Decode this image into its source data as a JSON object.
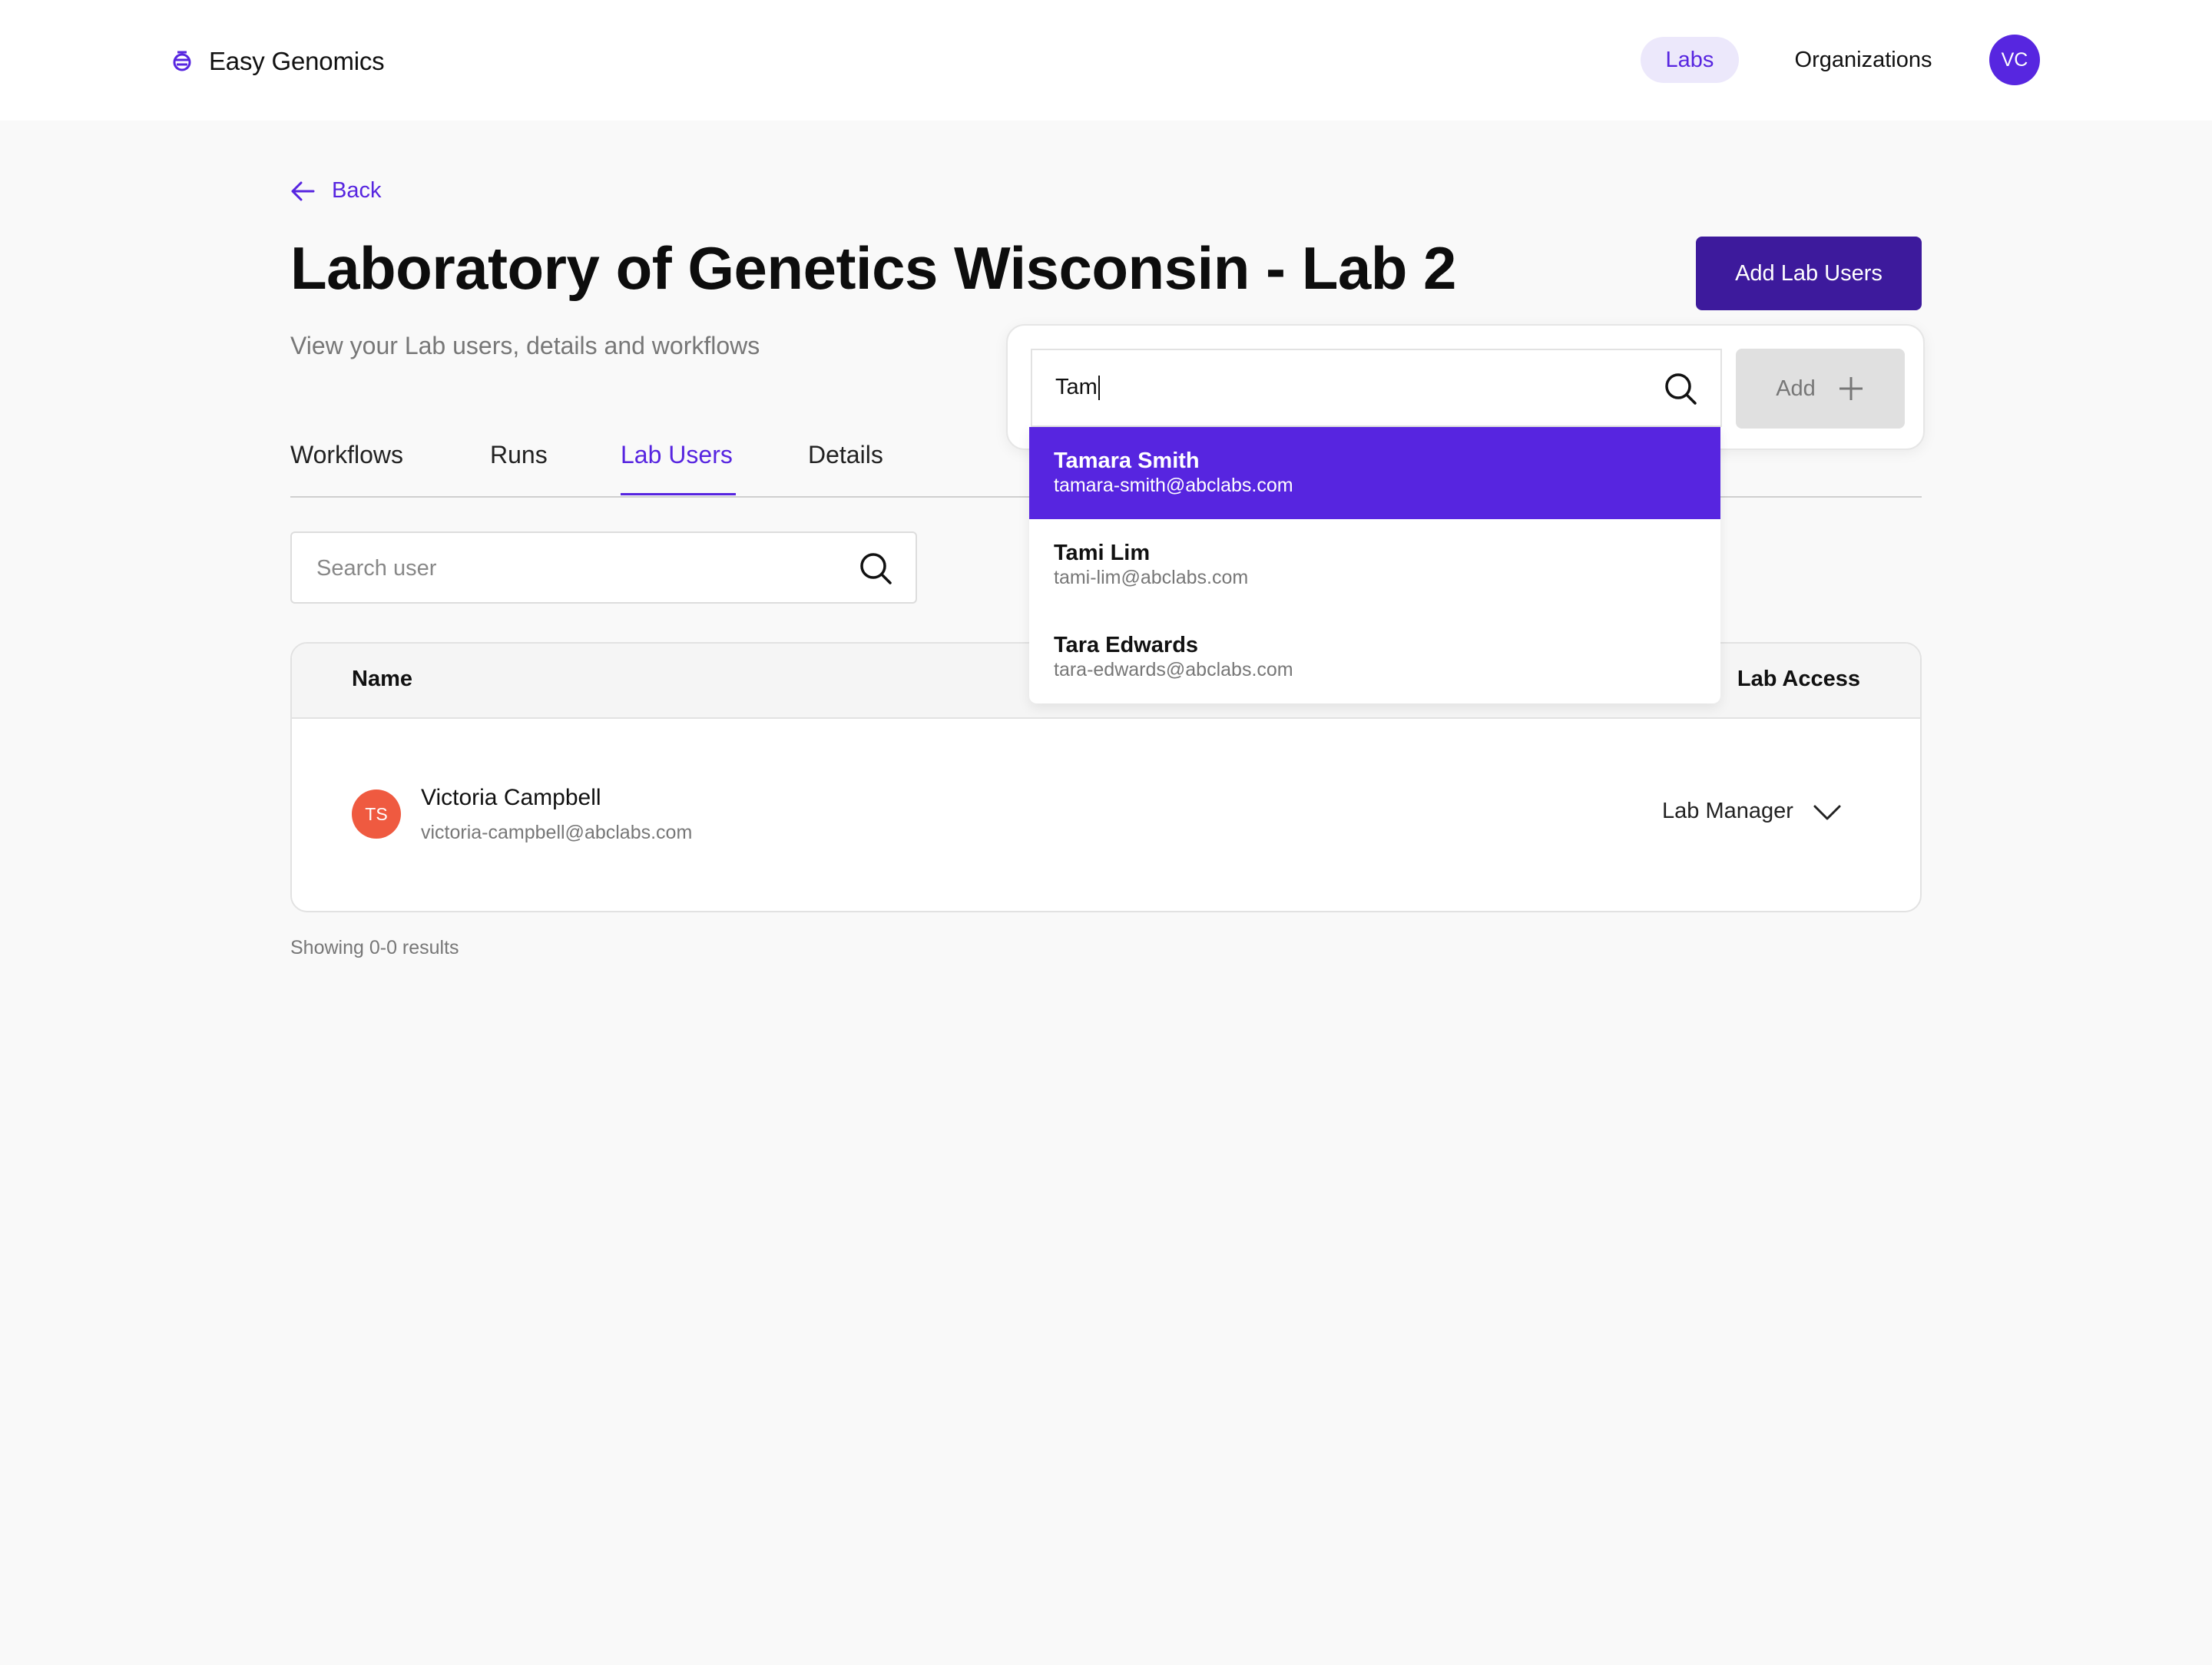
{
  "brand": {
    "name": "Easy Genomics",
    "icon": "genomics-logo-icon"
  },
  "nav": {
    "labs": "Labs",
    "organizations": "Organizations",
    "avatar_initials": "VC"
  },
  "back_label": "Back",
  "page": {
    "title": "Laboratory of Genetics Wisconsin - Lab 2",
    "subtitle": "View your Lab users, details and workflows",
    "add_lab_users_label": "Add Lab Users"
  },
  "tabs": [
    {
      "label": "Workflows"
    },
    {
      "label": "Runs"
    },
    {
      "label": "Lab Users",
      "active": true
    },
    {
      "label": "Details"
    }
  ],
  "search": {
    "placeholder": "Search user",
    "value": ""
  },
  "table": {
    "headers": {
      "name": "Name",
      "lab_access": "Lab Access"
    },
    "rows": [
      {
        "initials": "TS",
        "name": "Victoria Campbell",
        "email": "victoria-campbell@abclabs.com",
        "role": "Lab Manager"
      }
    ]
  },
  "results_text": "Showing 0-0 results",
  "add_user_popover": {
    "input_value": "Tam",
    "add_label": "Add",
    "options": [
      {
        "name": "Tamara Smith",
        "email": "tamara-smith@abclabs.com",
        "highlighted": true
      },
      {
        "name": "Tami Lim",
        "email": "tami-lim@abclabs.com"
      },
      {
        "name": "Tara Edwards",
        "email": "tara-edwards@abclabs.com"
      }
    ]
  },
  "colors": {
    "accent": "#5725e0",
    "primary_button": "#3d1a9c",
    "nav_active_bg": "#ece8fb",
    "avatar_row": "#ef5a40",
    "page_bg": "#f9f9f9"
  }
}
